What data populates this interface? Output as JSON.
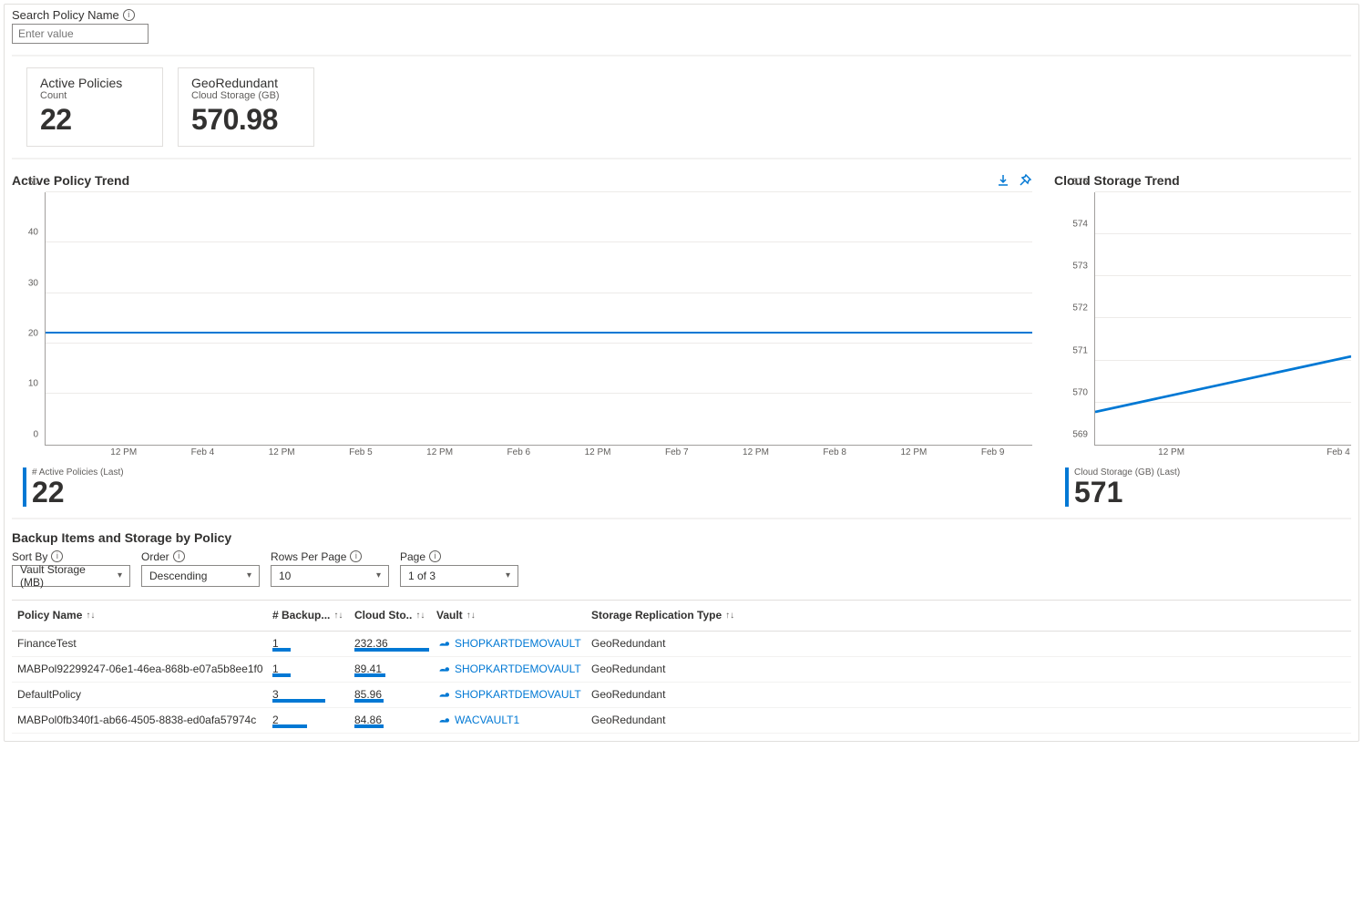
{
  "search": {
    "label": "Search Policy Name",
    "placeholder": "Enter value"
  },
  "cards": [
    {
      "title": "Active Policies",
      "sub": "Count",
      "value": "22"
    },
    {
      "title": "GeoRedundant",
      "sub": "Cloud Storage (GB)",
      "value": "570.98"
    }
  ],
  "chart_data": [
    {
      "type": "line",
      "title": "Active Policy Trend",
      "ylabel": "",
      "ylim": [
        0,
        50
      ],
      "yticks": [
        0,
        10,
        20,
        30,
        40,
        50
      ],
      "x": [
        "12 PM",
        "Feb 4",
        "12 PM",
        "Feb 5",
        "12 PM",
        "Feb 6",
        "12 PM",
        "Feb 7",
        "12 PM",
        "Feb 8",
        "12 PM",
        "Feb 9"
      ],
      "series": [
        {
          "name": "# Active Policies",
          "values": [
            22,
            22,
            22,
            22,
            22,
            22,
            22,
            22,
            22,
            22,
            22,
            22
          ]
        }
      ],
      "last": {
        "label": "# Active Policies (Last)",
        "value": "22"
      }
    },
    {
      "type": "line",
      "title": "Cloud Storage Trend",
      "ylim": [
        569,
        575
      ],
      "yticks": [
        569,
        570,
        571,
        572,
        573,
        574,
        575
      ],
      "x": [
        "12 PM",
        "Feb 4"
      ],
      "series": [
        {
          "name": "Cloud Storage (GB)",
          "values": [
            569.8,
            571.1
          ]
        }
      ],
      "last": {
        "label": "Cloud Storage (GB) (Last)",
        "value": "571"
      }
    }
  ],
  "table_section": {
    "title": "Backup Items and Storage by Policy",
    "controls": {
      "sort_by": {
        "label": "Sort By",
        "value": "Vault Storage (MB)"
      },
      "order": {
        "label": "Order",
        "value": "Descending"
      },
      "rows": {
        "label": "Rows Per Page",
        "value": "10"
      },
      "page": {
        "label": "Page",
        "value": "1 of 3"
      }
    },
    "columns": [
      "Policy Name",
      "# Backup...",
      "Cloud Sto..",
      "Vault",
      "Storage Replication Type"
    ],
    "rows": [
      {
        "name": "FinanceTest",
        "backup": 1,
        "backup_bar": 20,
        "storage": 232.36,
        "storage_bar": 82,
        "vault": "SHOPKARTDEMOVAULT",
        "repl": "GeoRedundant"
      },
      {
        "name": "MABPol92299247-06e1-46ea-868b-e07a5b8ee1f0",
        "backup": 1,
        "backup_bar": 20,
        "storage": 89.41,
        "storage_bar": 34,
        "vault": "SHOPKARTDEMOVAULT",
        "repl": "GeoRedundant"
      },
      {
        "name": "DefaultPolicy",
        "backup": 3,
        "backup_bar": 58,
        "storage": 85.96,
        "storage_bar": 32,
        "vault": "SHOPKARTDEMOVAULT",
        "repl": "GeoRedundant"
      },
      {
        "name": "MABPol0fb340f1-ab66-4505-8838-ed0afa57974c",
        "backup": 2,
        "backup_bar": 38,
        "storage": 84.86,
        "storage_bar": 32,
        "vault": "WACVAULT1",
        "repl": "GeoRedundant"
      }
    ]
  }
}
